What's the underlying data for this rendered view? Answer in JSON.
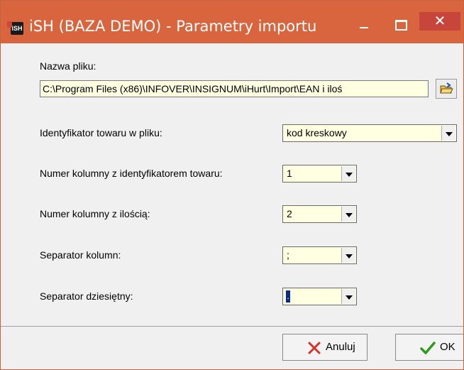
{
  "window": {
    "title": "iSH (BAZA DEMO) - Parametry importu",
    "app_icon_text": "iSH"
  },
  "titlebar_buttons": {
    "minimize": "–",
    "maximize": "□",
    "close": "✕"
  },
  "form": {
    "file_label": "Nazwa pliku:",
    "file_path": "C:\\Program Files (x86)\\INFOVER\\INSIGNUM\\iHurt\\Import\\EAN i iloś",
    "identifier_label": "Identyfikator towaru w pliku:",
    "identifier_value": "kod kreskowy",
    "id_column_label": "Numer kolumny z identyfikatorem towaru:",
    "id_column_value": "1",
    "qty_column_label": "Numer kolumny z ilością:",
    "qty_column_value": "2",
    "column_separator_label": "Separator kolumn:",
    "column_separator_value": ";",
    "decimal_separator_label": "Separator dziesiętny:",
    "decimal_separator_value": "."
  },
  "footer": {
    "cancel_label": "Anuluj",
    "ok_label": "OK"
  },
  "colors": {
    "titlebar": "#d9653f",
    "close_button": "#c7453b",
    "field_background": "#ffffe1",
    "cancel_icon": "#d2352b",
    "ok_icon": "#2f9a1e"
  }
}
